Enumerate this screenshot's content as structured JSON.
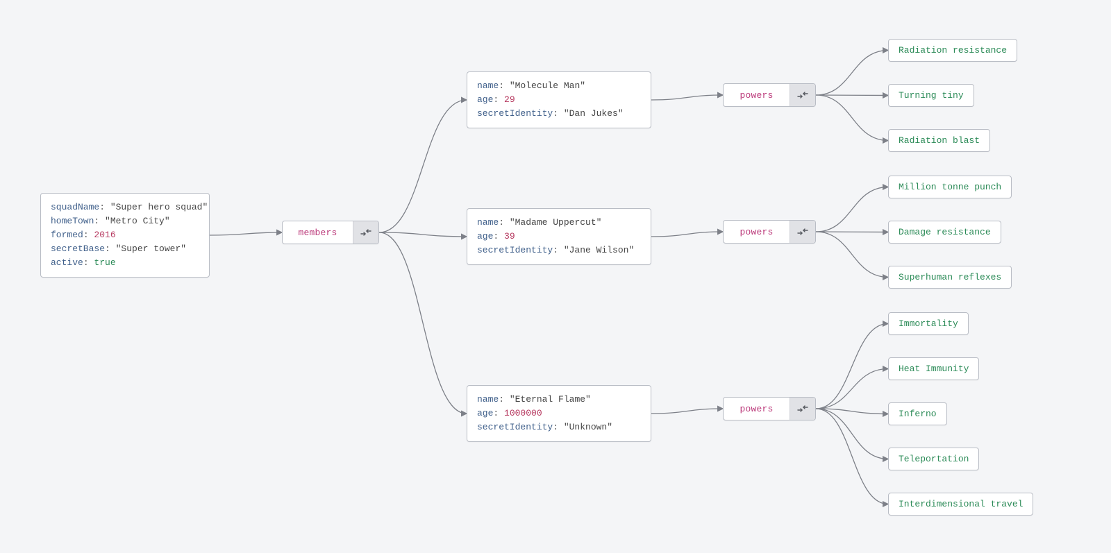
{
  "root": {
    "squadName": {
      "key": "squadName",
      "value": "\"Super hero squad\"",
      "type": "str"
    },
    "homeTown": {
      "key": "homeTown",
      "value": "\"Metro City\"",
      "type": "str"
    },
    "formed": {
      "key": "formed",
      "value": "2016",
      "type": "num"
    },
    "secretBase": {
      "key": "secretBase",
      "value": "\"Super tower\"",
      "type": "str"
    },
    "active": {
      "key": "active",
      "value": "true",
      "type": "bool"
    }
  },
  "membersLabel": "members",
  "members": [
    {
      "name": {
        "key": "name",
        "value": "\"Molecule Man\"",
        "type": "str"
      },
      "age": {
        "key": "age",
        "value": "29",
        "type": "num"
      },
      "secretIdentity": {
        "key": "secretIdentity",
        "value": "\"Dan Jukes\"",
        "type": "str"
      },
      "powersLabel": "powers",
      "powers": [
        "Radiation resistance",
        "Turning tiny",
        "Radiation blast"
      ]
    },
    {
      "name": {
        "key": "name",
        "value": "\"Madame Uppercut\"",
        "type": "str"
      },
      "age": {
        "key": "age",
        "value": "39",
        "type": "num"
      },
      "secretIdentity": {
        "key": "secretIdentity",
        "value": "\"Jane Wilson\"",
        "type": "str"
      },
      "powersLabel": "powers",
      "powers": [
        "Million tonne punch",
        "Damage resistance",
        "Superhuman reflexes"
      ]
    },
    {
      "name": {
        "key": "name",
        "value": "\"Eternal Flame\"",
        "type": "str"
      },
      "age": {
        "key": "age",
        "value": "1000000",
        "type": "num"
      },
      "secretIdentity": {
        "key": "secretIdentity",
        "value": "\"Unknown\"",
        "type": "str"
      },
      "powersLabel": "powers",
      "powers": [
        "Immortality",
        "Heat Immunity",
        "Inferno",
        "Teleportation",
        "Interdimensional travel"
      ]
    }
  ]
}
